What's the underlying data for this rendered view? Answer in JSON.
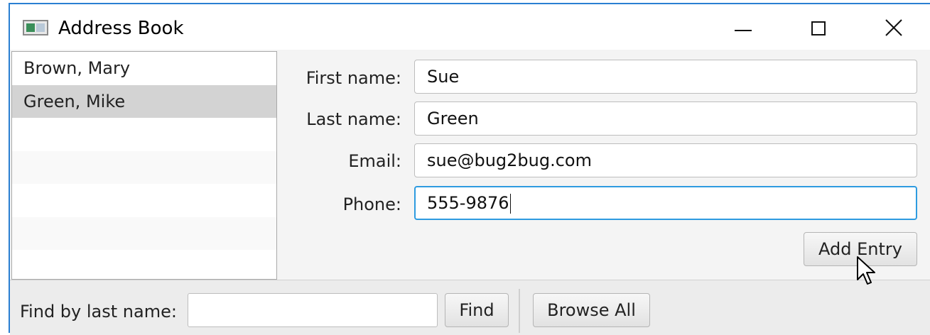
{
  "window": {
    "title": "Address Book",
    "icon": "java-app-window-icon",
    "controls": [
      "minimize-icon",
      "maximize-icon",
      "close-icon"
    ]
  },
  "contacts": {
    "items": [
      {
        "label": "Brown, Mary",
        "selected": false
      },
      {
        "label": "Green, Mike",
        "selected": true
      }
    ]
  },
  "form": {
    "first_name_label": "First name:",
    "first_name_value": "Sue",
    "last_name_label": "Last name:",
    "last_name_value": "Green",
    "email_label": "Email:",
    "email_value": "sue@bug2bug.com",
    "phone_label": "Phone:",
    "phone_value": "555-9876",
    "add_button": "Add Entry"
  },
  "footer": {
    "find_label": "Find by last name:",
    "find_value": "",
    "find_button": "Find",
    "browse_button": "Browse All"
  },
  "colors": {
    "window_border": "#2a7fd2",
    "focus_ring": "#2e9be0",
    "selection": "#d3d3d3"
  }
}
